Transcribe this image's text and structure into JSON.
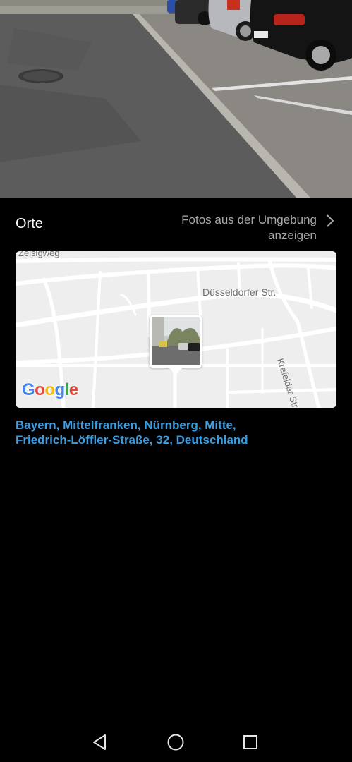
{
  "places": {
    "title": "Orte",
    "nearby_link_line1": "Fotos aus der Umgebung",
    "nearby_link_line2": "anzeigen",
    "nearby_icon": "chevron-right-icon"
  },
  "map": {
    "streets": {
      "zeisigweg": "Zeisigweg",
      "duesseldorfer": "Düsseldorfer Str.",
      "krefelder": "Krefelder Str."
    },
    "logo": {
      "letters": [
        "G",
        "o",
        "o",
        "g",
        "l",
        "e"
      ],
      "colors": [
        "#4285F4",
        "#EA4335",
        "#FBBC05",
        "#4285F4",
        "#34A853",
        "#EA4335"
      ]
    },
    "road_color": "#ffffff",
    "background_color": "#eeeeee"
  },
  "address": {
    "line1": "Bayern, Mittelfranken, Nürnberg, Mitte,",
    "line2": "Friedrich-Löffler-Straße, 32, Deutschland",
    "color": "#3a9ee4"
  },
  "navigation": {
    "back_icon": "back-triangle-icon",
    "home_icon": "home-circle-icon",
    "recent_icon": "recent-apps-square-icon"
  }
}
